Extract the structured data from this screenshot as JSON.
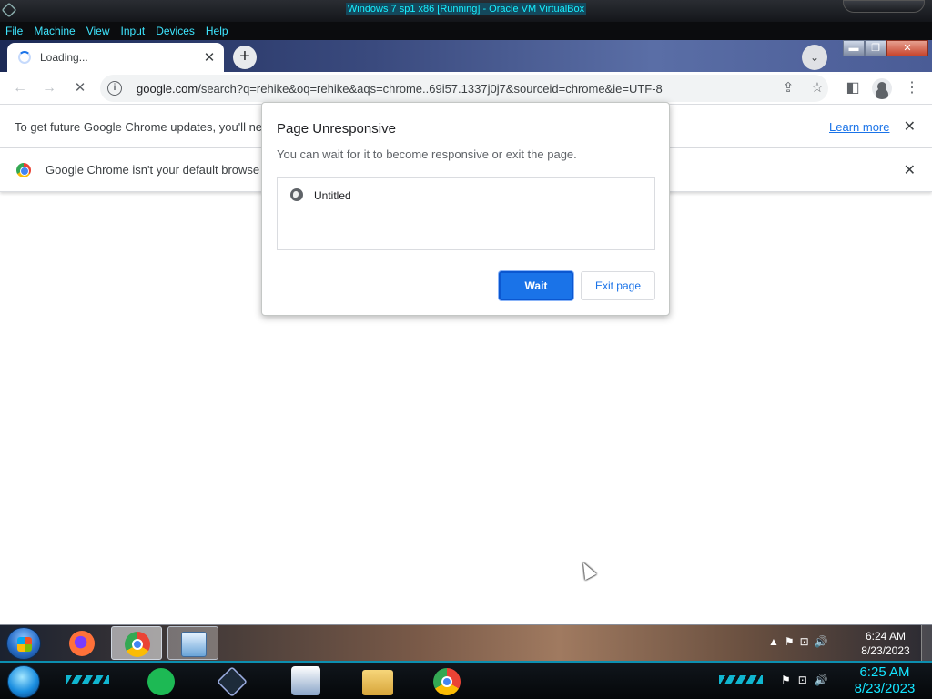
{
  "vbox": {
    "title": "Windows 7 sp1 x86 [Running] - Oracle VM VirtualBox",
    "menu": [
      "File",
      "Machine",
      "View",
      "Input",
      "Devices",
      "Help"
    ]
  },
  "chrome": {
    "tab": {
      "title": "Loading..."
    },
    "url": {
      "host": "google.com",
      "path": "/search?q=rehike&oq=rehike&aqs=chrome..69i57.1337j0j7&sourceid=chrome&ie=UTF-8"
    },
    "infobar_update": {
      "text": "To get future Google Chrome updates, you'll ne",
      "link": "Learn more"
    },
    "infobar_default": {
      "text": "Google Chrome isn't your default browse"
    }
  },
  "dialog": {
    "title": "Page Unresponsive",
    "message": "You can wait for it to become responsive or exit the page.",
    "items": [
      "Untitled"
    ],
    "wait_label": "Wait",
    "exit_label": "Exit page"
  },
  "guest_taskbar": {
    "time": "6:24 AM",
    "date": "8/23/2023"
  },
  "host_taskbar": {
    "time": "6:25 AM",
    "date": "8/23/2023"
  },
  "icons": {
    "back": "arrow-left-icon",
    "forward": "arrow-right-icon",
    "reload": "stop-loading-icon",
    "share": "share-icon",
    "bookmark": "star-icon",
    "side_panel": "side-panel-icon",
    "menu": "kebab-menu-icon",
    "close": "close-icon"
  },
  "colors": {
    "accent": "#1a73e8",
    "vbox_title": "#18f0ff",
    "vbox_menu": "#3ee6ff"
  }
}
